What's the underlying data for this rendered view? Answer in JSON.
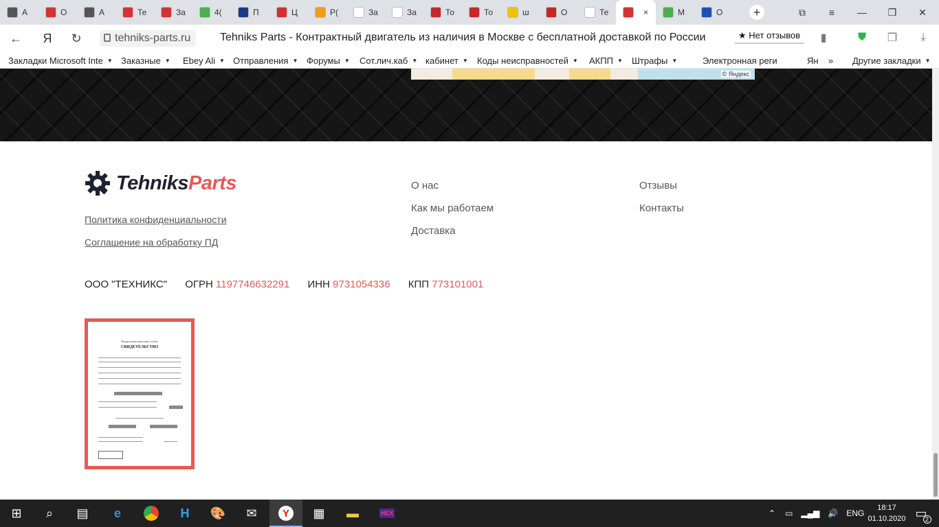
{
  "browser": {
    "tabs": [
      {
        "label": "А",
        "icon": "document-icon",
        "color": "#555555"
      },
      {
        "label": "О",
        "icon": "gear-red-icon",
        "color": "#d33333"
      },
      {
        "label": "А",
        "icon": "document-icon",
        "color": "#555555"
      },
      {
        "label": "Те",
        "icon": "gear-red-icon",
        "color": "#d33333"
      },
      {
        "label": "За",
        "icon": "gear-red-icon",
        "color": "#d33333"
      },
      {
        "label": "4(",
        "icon": "circle-multicolor-icon",
        "color": "#4caf50"
      },
      {
        "label": "П",
        "icon": "flag-icon",
        "color": "#1a3a8a"
      },
      {
        "label": "Ц",
        "icon": "red-circle-icon",
        "color": "#d32f2f"
      },
      {
        "label": "Р(",
        "icon": "e-orange-icon",
        "color": "#f39c12"
      },
      {
        "label": "За",
        "icon": "yandex-icon",
        "color": "#ffffff"
      },
      {
        "label": "За",
        "icon": "google-icon",
        "color": "#ffffff"
      },
      {
        "label": "То",
        "icon": "d-red-icon",
        "color": "#c62828"
      },
      {
        "label": "То",
        "icon": "d-red-icon",
        "color": "#c62828"
      },
      {
        "label": "ш",
        "icon": "photo-icon",
        "color": "#f2c200"
      },
      {
        "label": "О",
        "icon": "power-red-icon",
        "color": "#c62828"
      },
      {
        "label": "Те",
        "icon": "yandex-icon",
        "color": "#ffffff"
      },
      {
        "label": "",
        "icon": "gear-red-icon",
        "color": "#d33333",
        "active": true
      },
      {
        "label": "М",
        "icon": "check-icon",
        "color": "#4caf50"
      },
      {
        "label": "О",
        "icon": "russia-flag-icon",
        "color": "#1e4fb8"
      }
    ],
    "active_tab_close": "×",
    "new_tab": "+",
    "url_host": "tehniks-parts.ru",
    "page_title": "Tehniks Parts - Контрактный двигатель из наличия в Москве с бесплатной доставкой по России",
    "reviews_label": "★ Нет отзывов",
    "bookmarks": [
      {
        "label": "Закладки Microsoft Inte",
        "caret": true
      },
      {
        "label": "Заказные",
        "caret": true
      },
      {
        "label": "Ebey Ali",
        "caret": true
      },
      {
        "label": "Отправления",
        "caret": true
      },
      {
        "label": "Форумы",
        "caret": true
      },
      {
        "label": "Сот.лич.каб",
        "caret": true
      },
      {
        "label": "кабинет",
        "caret": true
      },
      {
        "label": "Коды неисправностей",
        "caret": true
      },
      {
        "label": "АКПП",
        "caret": true
      },
      {
        "label": "Штрафы",
        "caret": true
      },
      {
        "label": "Электронная реги",
        "caret": false
      },
      {
        "label": "Ян",
        "caret": false
      },
      {
        "label": "»",
        "caret": false
      },
      {
        "label": "Другие закладки",
        "caret": true
      }
    ]
  },
  "map": {
    "copyright": "© Яндекс"
  },
  "footer": {
    "logo": {
      "part1": "Tehniks",
      "part2": "Parts"
    },
    "links": {
      "privacy": "Политика конфиденциальности",
      "agreement": "Соглашение на обработку ПД"
    },
    "menu_col1": [
      "О нас",
      "Как мы работаем",
      "Доставка"
    ],
    "menu_col2": [
      "Отзывы",
      "Контакты"
    ],
    "legal": {
      "company": "ООО \"ТЕХНИКС\"",
      "ogrn_label": "ОГРН",
      "ogrn": "1197746632291",
      "inn_label": "ИНН",
      "inn": "9731054336",
      "kpp_label": "КПП",
      "kpp": "773101001"
    },
    "certificate": {
      "title": "СВИДЕТЕЛЬСТВО",
      "subtitle": "Федеральная налоговая служба"
    },
    "accent_color": "#e35a5a"
  },
  "taskbar": {
    "apps": [
      "start-icon",
      "search-icon",
      "task-view-icon",
      "edge-icon",
      "chrome-icon",
      "app-icon",
      "paint-icon",
      "mail-icon",
      "yandex-browser-icon",
      "calculator-icon",
      "folder-icon",
      "hex-editor-icon"
    ],
    "language": "ENG",
    "time": "18:17",
    "date": "01.10.2020",
    "notification_count": "2"
  }
}
